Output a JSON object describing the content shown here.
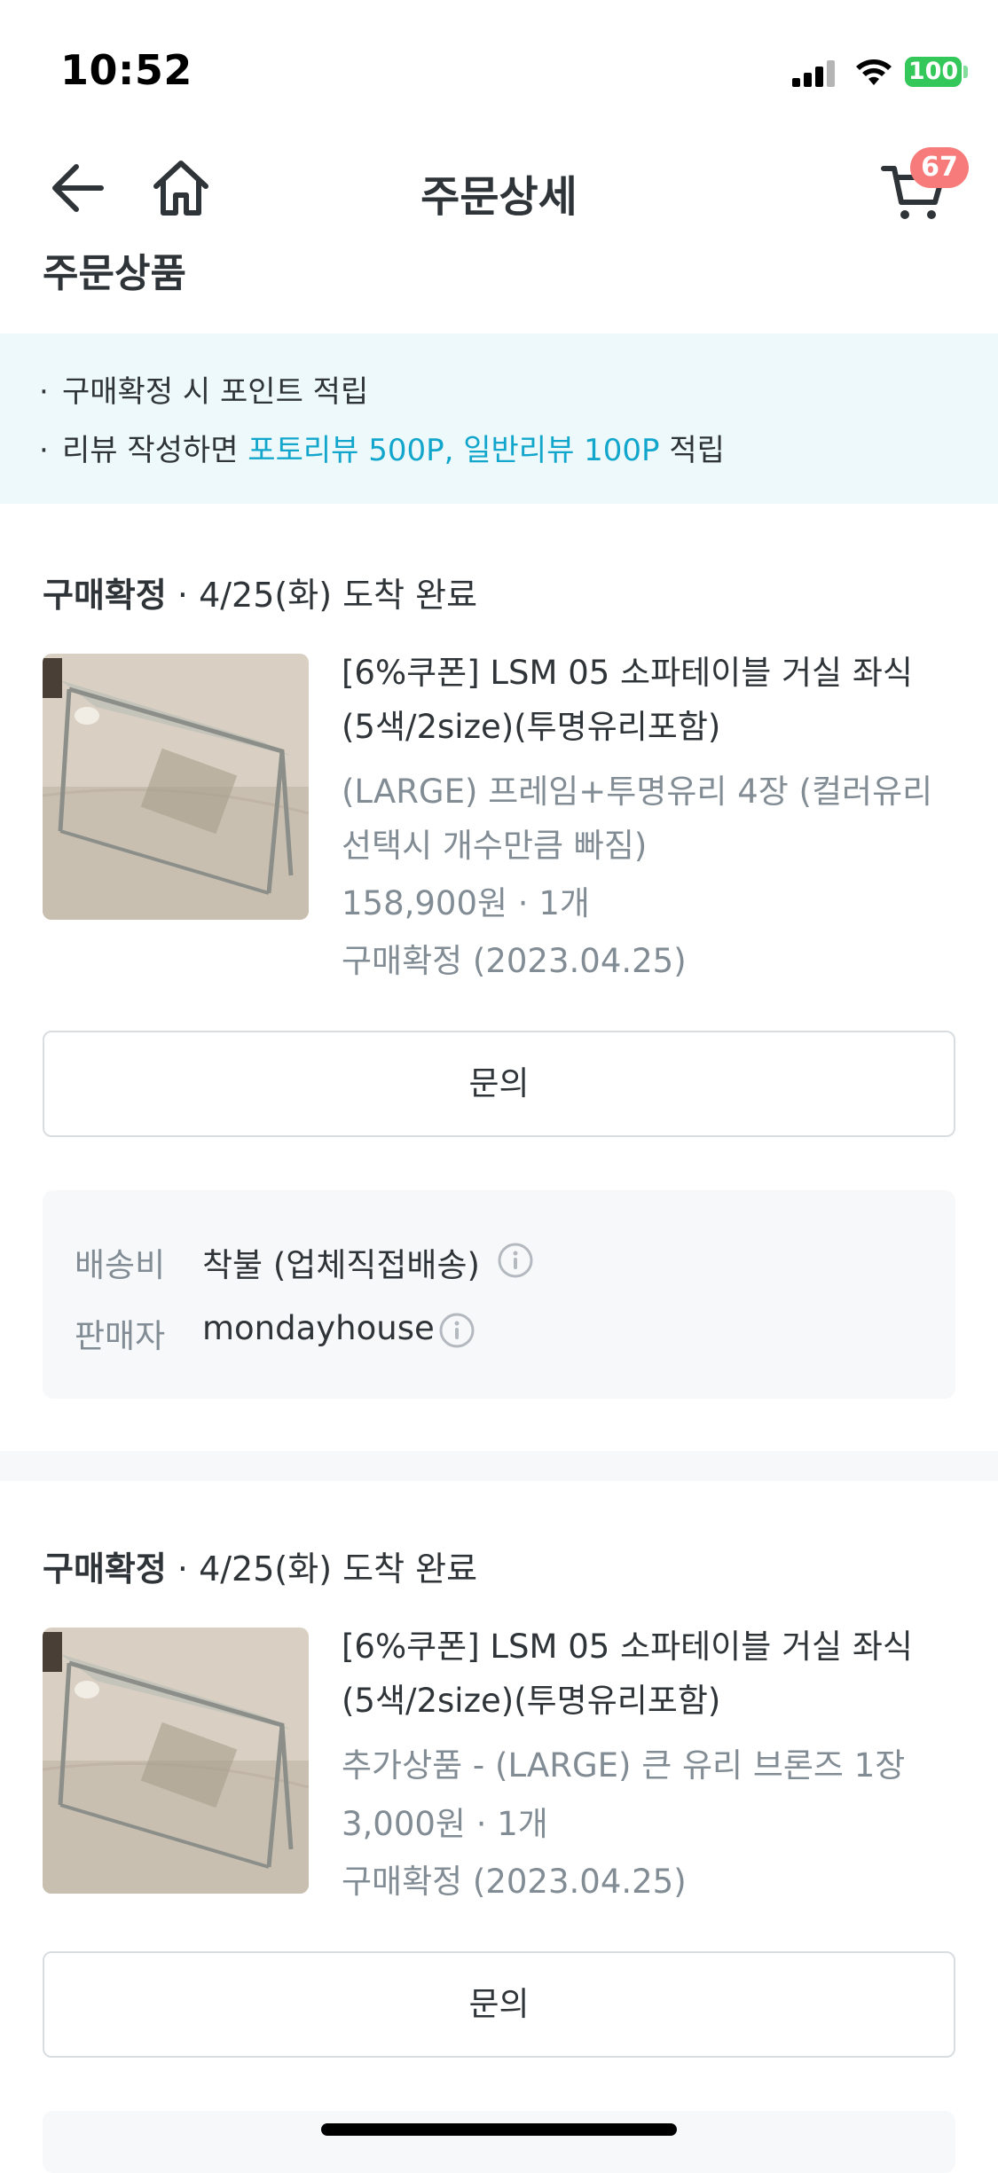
{
  "status_bar": {
    "time": "10:52",
    "battery": "100"
  },
  "nav": {
    "title": "주문상세",
    "cart_count": "67"
  },
  "section_title": "주문상품",
  "notice": {
    "line1": "구매확정 시 포인트 적립",
    "line2_prefix": "리뷰 작성하면 ",
    "line2_highlight": "포토리뷰 500P, 일반리뷰 100P",
    "line2_suffix": " 적립"
  },
  "orders": [
    {
      "status": "구매확정",
      "arrival": " · 4/25(화) 도착 완료",
      "title_line1": "[6%쿠폰] LSM 05 소파테이블 거실 좌식",
      "title_line2": "(5색/2size)(투명유리포함)",
      "option_line1": "(LARGE) 프레임+투명유리 4장 (컬러유리",
      "option_line2": "선택시 개수만큼 빠짐)",
      "price_qty": "158,900원 · 1개",
      "confirm": "구매확정 (2023.04.25)",
      "inquiry_label": "문의",
      "shipping_label": "배송비",
      "shipping_value": "착불 (업체직접배송)",
      "seller_label": "판매자",
      "seller_value": "mondayhouse"
    },
    {
      "status": "구매확정",
      "arrival": " · 4/25(화) 도착 완료",
      "title_line1": "[6%쿠폰] LSM 05 소파테이블 거실 좌식",
      "title_line2": "(5색/2size)(투명유리포함)",
      "option_line1": "추가상품 - (LARGE) 큰 유리 브론즈 1장",
      "price_qty": "3,000원 · 1개",
      "confirm": "구매확정 (2023.04.25)",
      "inquiry_label": "문의"
    }
  ],
  "colors": {
    "accent": "#12a6cc",
    "badge": "#f77b7b",
    "battery": "#34c759"
  },
  "icons": [
    "back-arrow-icon",
    "home-icon",
    "cart-icon",
    "info-icon"
  ]
}
